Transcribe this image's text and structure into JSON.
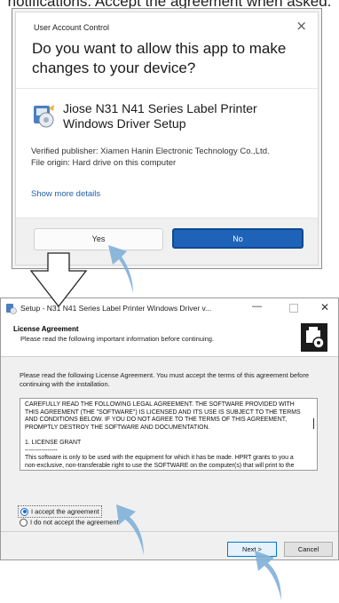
{
  "instruction": "notifications. Accept the agreement when asked.",
  "uac": {
    "title": "User Account Control",
    "close": "×",
    "question": "Do you want to allow this app to make changes to your device?",
    "app_name": "Jiose N31 N41 Series Label Printer Windows Driver Setup",
    "publisher": "Verified publisher: Xiamen Hanin Electronic Technology Co.,Ltd.",
    "origin": "File origin: Hard drive on this computer",
    "details_link": "Show more details",
    "yes_label": "Yes",
    "no_label": "No"
  },
  "setup": {
    "title": "Setup - N31 N41 Series Label Printer Windows Driver v...",
    "min": "—",
    "close": "✕",
    "header_title": "License Agreement",
    "header_sub": "Please read the following important information before continuing.",
    "intro": "Please read the following License Agreement. You must accept the terms of this agreement before continuing with the installation.",
    "license_text": "CAREFULLY READ THE FOLLOWING LEGAL AGREEMENT. THE SOFTWARE PROVIDED WITH THIS AGREEMENT (THE \"SOFTWARE\") IS LICENSED AND ITS USE IS SUBJECT TO THE TERMS AND CONDITIONS BELOW. IF YOU DO NOT AGREE TO THE TERMS OF THIS AGREEMENT, PROMPTLY DESTROY THE SOFTWARE AND DOCUMENTATION.\n\n1. LICENSE GRANT\n----------------\nThis software is only to be used with the equipment for which it has be made. HPRT grants to you a non-exclusive, non-transferable right to use the SOFTWARE on the computer(s) that will print to the thermal printer(s). This",
    "accept_label": "I accept the agreement",
    "decline_label": "I do not accept the agreement",
    "accept_selected": true,
    "next_label": "Next >",
    "cancel_label": "Cancel"
  },
  "colors": {
    "arrow": "#7fb0d8",
    "primary_button": "#1e63b8"
  }
}
